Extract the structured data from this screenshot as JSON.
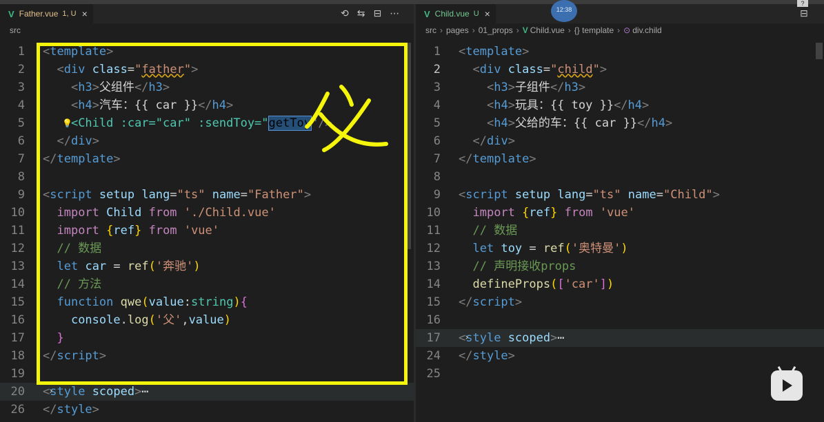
{
  "left": {
    "tab": {
      "filename": "Father.vue",
      "status": "1, U",
      "close": "×"
    },
    "actions": [
      "⟲",
      "⇆",
      "⊟",
      "⋯"
    ],
    "lines": [
      {
        "n": "1"
      },
      {
        "n": "2"
      },
      {
        "n": "3",
        "a": "<h3>",
        "b": "父组件",
        "c": "</h3>"
      },
      {
        "n": "4",
        "a": "<h4>",
        "b": "汽车：{{ car }}",
        "c": "</h4>"
      },
      {
        "n": "5"
      },
      {
        "n": "6"
      },
      {
        "n": "7"
      },
      {
        "n": "8"
      },
      {
        "n": "9"
      },
      {
        "n": "10"
      },
      {
        "n": "11"
      },
      {
        "n": "12",
        "cmt": "// 数据"
      },
      {
        "n": "13",
        "s": "'奔驰'"
      },
      {
        "n": "14",
        "cmt": "// 方法"
      },
      {
        "n": "15"
      },
      {
        "n": "16",
        "s": "'父'"
      },
      {
        "n": "17"
      },
      {
        "n": "18"
      },
      {
        "n": "19"
      },
      {
        "n": "20"
      },
      {
        "n": "26"
      }
    ],
    "father_class": "father",
    "script_name": "Father",
    "import1": "'./Child.vue'",
    "import2": "'vue'",
    "child_tag": "<Child :car=\"car\" :sendToy=\"",
    "selected": "getToy",
    "child_tail": "\"/>",
    "handwritten": "父"
  },
  "right": {
    "tab": {
      "filename": "Child.vue",
      "status": "U",
      "close": "×"
    },
    "breadcrumb": [
      "src",
      "pages",
      "01_props",
      "Child.vue",
      "{} template",
      "div.child"
    ],
    "lines": [
      {
        "n": "1"
      },
      {
        "n": "2"
      },
      {
        "n": "3"
      },
      {
        "n": "4"
      },
      {
        "n": "5"
      },
      {
        "n": "6"
      },
      {
        "n": "7"
      },
      {
        "n": "8"
      },
      {
        "n": "9"
      },
      {
        "n": "10"
      },
      {
        "n": "11"
      },
      {
        "n": "12"
      },
      {
        "n": "13"
      },
      {
        "n": "14"
      },
      {
        "n": "15"
      },
      {
        "n": "16"
      },
      {
        "n": "17"
      },
      {
        "n": "24"
      },
      {
        "n": "25"
      }
    ],
    "h3": "子组件",
    "h4a": "玩具：{{ toy }}",
    "h4b": "父给的车：{{ car }}",
    "child_class": "child",
    "script_name": "Child",
    "import": "'vue'",
    "cmt1": "// 数据",
    "toy_val": "'奥特曼'",
    "cmt2": "// 声明接收props",
    "props": "'car'"
  },
  "left_breadcrumb": "src",
  "avatar_text": "12:38",
  "colors": {
    "box": "#f5f50c",
    "vue": "#41b883",
    "tab_modified": "#e2c08d"
  }
}
